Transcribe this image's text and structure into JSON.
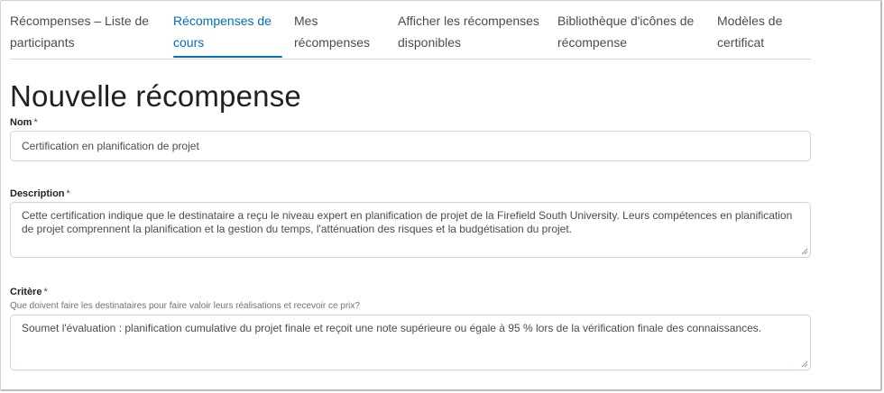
{
  "tabs": [
    {
      "line1": "Récompenses – Liste de",
      "line2": "participants",
      "active": false
    },
    {
      "line1": "Récompenses de",
      "line2": "cours",
      "active": true
    },
    {
      "line1": "Mes",
      "line2": "récompenses",
      "active": false
    },
    {
      "line1": "Afficher les récompenses",
      "line2": "disponibles",
      "active": false
    },
    {
      "line1": "Bibliothèque d'icônes de",
      "line2": "récompense",
      "active": false
    },
    {
      "line1": "Modèles de",
      "line2": "certificat",
      "active": false
    }
  ],
  "page_title": "Nouvelle récompense",
  "form": {
    "name": {
      "label": "Nom",
      "required_mark": "*",
      "value": "Certification en planification de projet"
    },
    "description": {
      "label": "Description",
      "required_mark": "*",
      "value": "Cette certification indique que le destinataire a reçu le niveau expert en planification de projet de la Firefield South University. Leurs compétences en planification de projet comprennent la planification et la gestion du temps, l'atténuation des risques et la budgétisation du projet."
    },
    "criteria": {
      "label": "Critère",
      "required_mark": "*",
      "help": "Que doivent faire les destinataires pour faire valoir leurs réalisations et recevoir ce prix?",
      "value": "Soumet l'évaluation : planification cumulative du projet finale et reçoit une note supérieure ou égale à 95 % lors de la vérification finale des connaissances."
    }
  },
  "colors": {
    "accent": "#006fbf",
    "border": "#cdd5dc",
    "text": "#202122"
  }
}
